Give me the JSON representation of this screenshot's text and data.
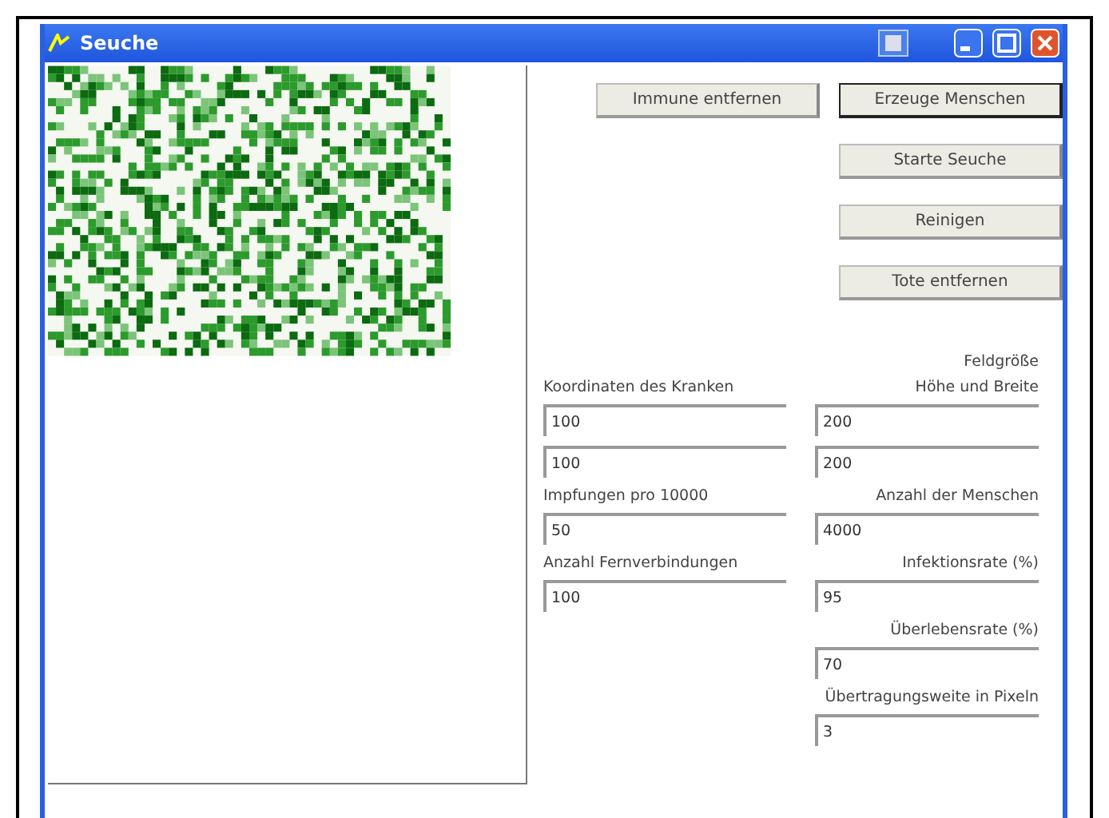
{
  "window": {
    "title": "Seuche"
  },
  "buttons_top": [
    {
      "label": "Immune entfernen",
      "focused": false
    },
    {
      "label": "Erzeuge Menschen",
      "focused": true
    }
  ],
  "buttons": [
    {
      "label": "Starte Seuche",
      "focused": false
    },
    {
      "label": "Reinigen",
      "focused": false
    },
    {
      "label": "Tote entfernen",
      "focused": false
    }
  ],
  "form_rows": [
    {
      "left": {
        "kind": "empty"
      },
      "right": {
        "kind": "label",
        "text": "Feldgröße"
      }
    },
    {
      "left": {
        "kind": "label",
        "text": "Koordinaten des Kranken"
      },
      "right": {
        "kind": "label",
        "text": "Höhe und Breite"
      }
    },
    {
      "left": {
        "kind": "field",
        "value": "100"
      },
      "right": {
        "kind": "field",
        "value": "200"
      }
    },
    {
      "left": {
        "kind": "field",
        "value": "100"
      },
      "right": {
        "kind": "field",
        "value": "200"
      }
    },
    {
      "left": {
        "kind": "label",
        "text": "Impfungen pro 10000"
      },
      "right": {
        "kind": "label",
        "text": "Anzahl der Menschen"
      }
    },
    {
      "left": {
        "kind": "field",
        "value": "50"
      },
      "right": {
        "kind": "field",
        "value": "4000"
      }
    },
    {
      "left": {
        "kind": "label",
        "text": "Anzahl Fernverbindungen"
      },
      "right": {
        "kind": "label",
        "text": "Infektionsrate (%)"
      }
    },
    {
      "left": {
        "kind": "field",
        "value": "100"
      },
      "right": {
        "kind": "field",
        "value": "95"
      }
    },
    {
      "left": {
        "kind": "empty"
      },
      "right": {
        "kind": "label",
        "text": "Überlebensrate (%)"
      }
    },
    {
      "left": {
        "kind": "empty"
      },
      "right": {
        "kind": "field",
        "value": "70"
      }
    },
    {
      "left": {
        "kind": "empty"
      },
      "right": {
        "kind": "label",
        "text": "Übertragungsweite in Pixeln"
      }
    },
    {
      "left": {
        "kind": "empty"
      },
      "right": {
        "kind": "field",
        "value": "3"
      }
    }
  ]
}
